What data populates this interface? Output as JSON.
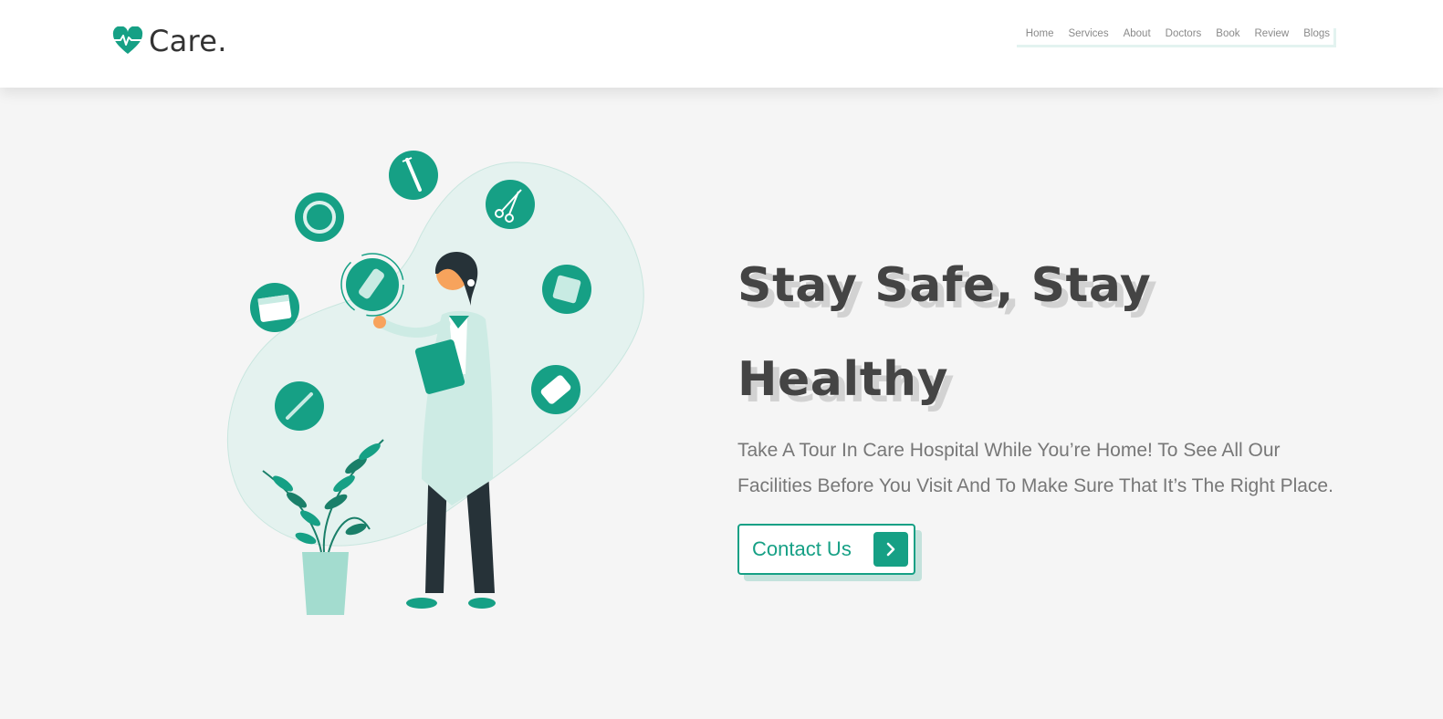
{
  "brand": {
    "name": "Care.",
    "accent": "#16a085"
  },
  "nav": {
    "items": [
      "Home",
      "Services",
      "About",
      "Doctors",
      "Book",
      "Review",
      "Blogs"
    ]
  },
  "hero": {
    "title_line1": "Stay Safe, Stay",
    "title_line2": "Healthy",
    "description": "Take A Tour In Care Hospital While You’re Home! To See All Our Facilities Before You Visit And To Make Sure That It’s The Right Place.",
    "cta_label": "Contact Us",
    "cta_icon": "chevron-right-icon"
  },
  "illustration": {
    "icons": [
      "syringe-icon",
      "scissors-icon",
      "ring-icon",
      "calendar-icon",
      "bandage-icon",
      "gauze-icon",
      "pills-icon",
      "thermometer-icon"
    ]
  }
}
